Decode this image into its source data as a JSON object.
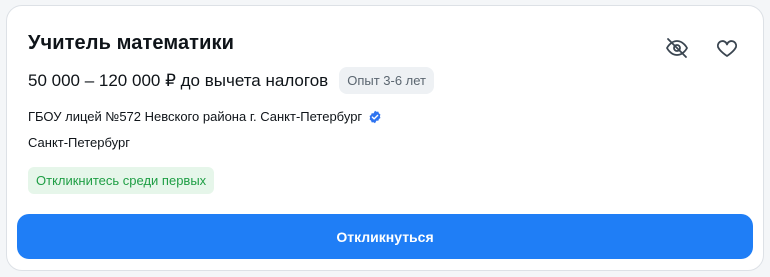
{
  "vacancy": {
    "title": "Учитель математики",
    "salary": "50 000 – 120 000 ₽ до вычета налогов",
    "experience": "Опыт 3-6 лет",
    "company": "ГБОУ лицей №572 Невского района г. Санкт-Петербург",
    "city": "Санкт-Петербург",
    "early_badge": "Откликнитесь среди первых",
    "apply_label": "Откликнуться"
  },
  "icons": {
    "hide": "eye-off-icon",
    "favorite": "heart-icon",
    "verified": "verified-check-icon"
  },
  "colors": {
    "accent": "#1f7ef6",
    "badge_green_bg": "#e6f6ea",
    "badge_green_text": "#1f9e45",
    "badge_gray_bg": "#eef1f4",
    "verified": "#2f74f0"
  }
}
